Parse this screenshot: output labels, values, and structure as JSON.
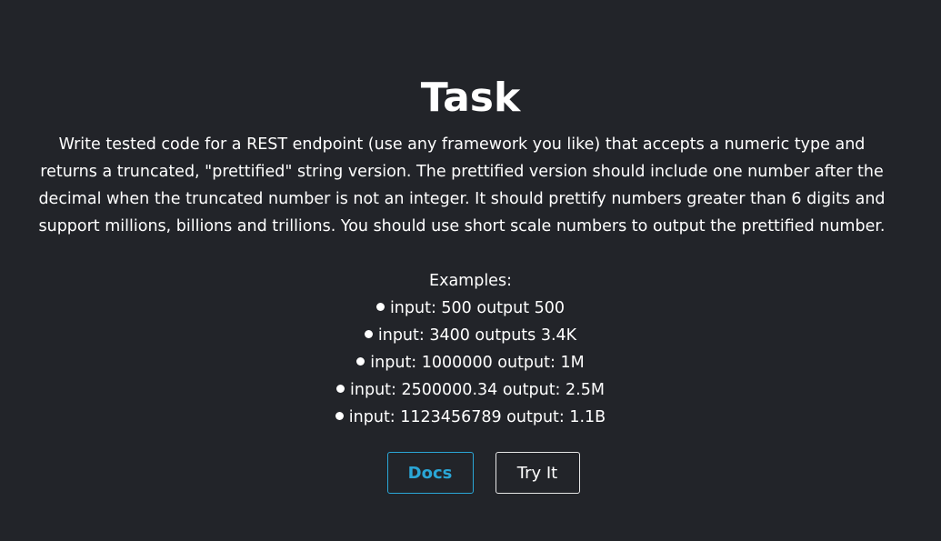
{
  "header": {
    "title": "Task"
  },
  "task": {
    "description": "Write tested code for a REST endpoint (use any framework you like) that accepts a numeric type and returns a truncated, \"prettified\" string version. The prettified version should include one number after the decimal when the truncated number is not an integer. It should prettify numbers greater than 6 digits and support millions, billions and trillions. You should use short scale numbers to output the prettified number.",
    "examples_heading": "Examples:",
    "examples": [
      "input: 500 output 500",
      "input: 3400 outputs 3.4K",
      "input: 1000000 output: 1M",
      "input: 2500000.34 output: 2.5M",
      "input: 1123456789 output: 1.1B"
    ]
  },
  "actions": {
    "docs_label": "Docs",
    "try_label": "Try It"
  },
  "colors": {
    "background": "#222429",
    "text": "#ffffff",
    "accent": "#2aa6d6"
  }
}
